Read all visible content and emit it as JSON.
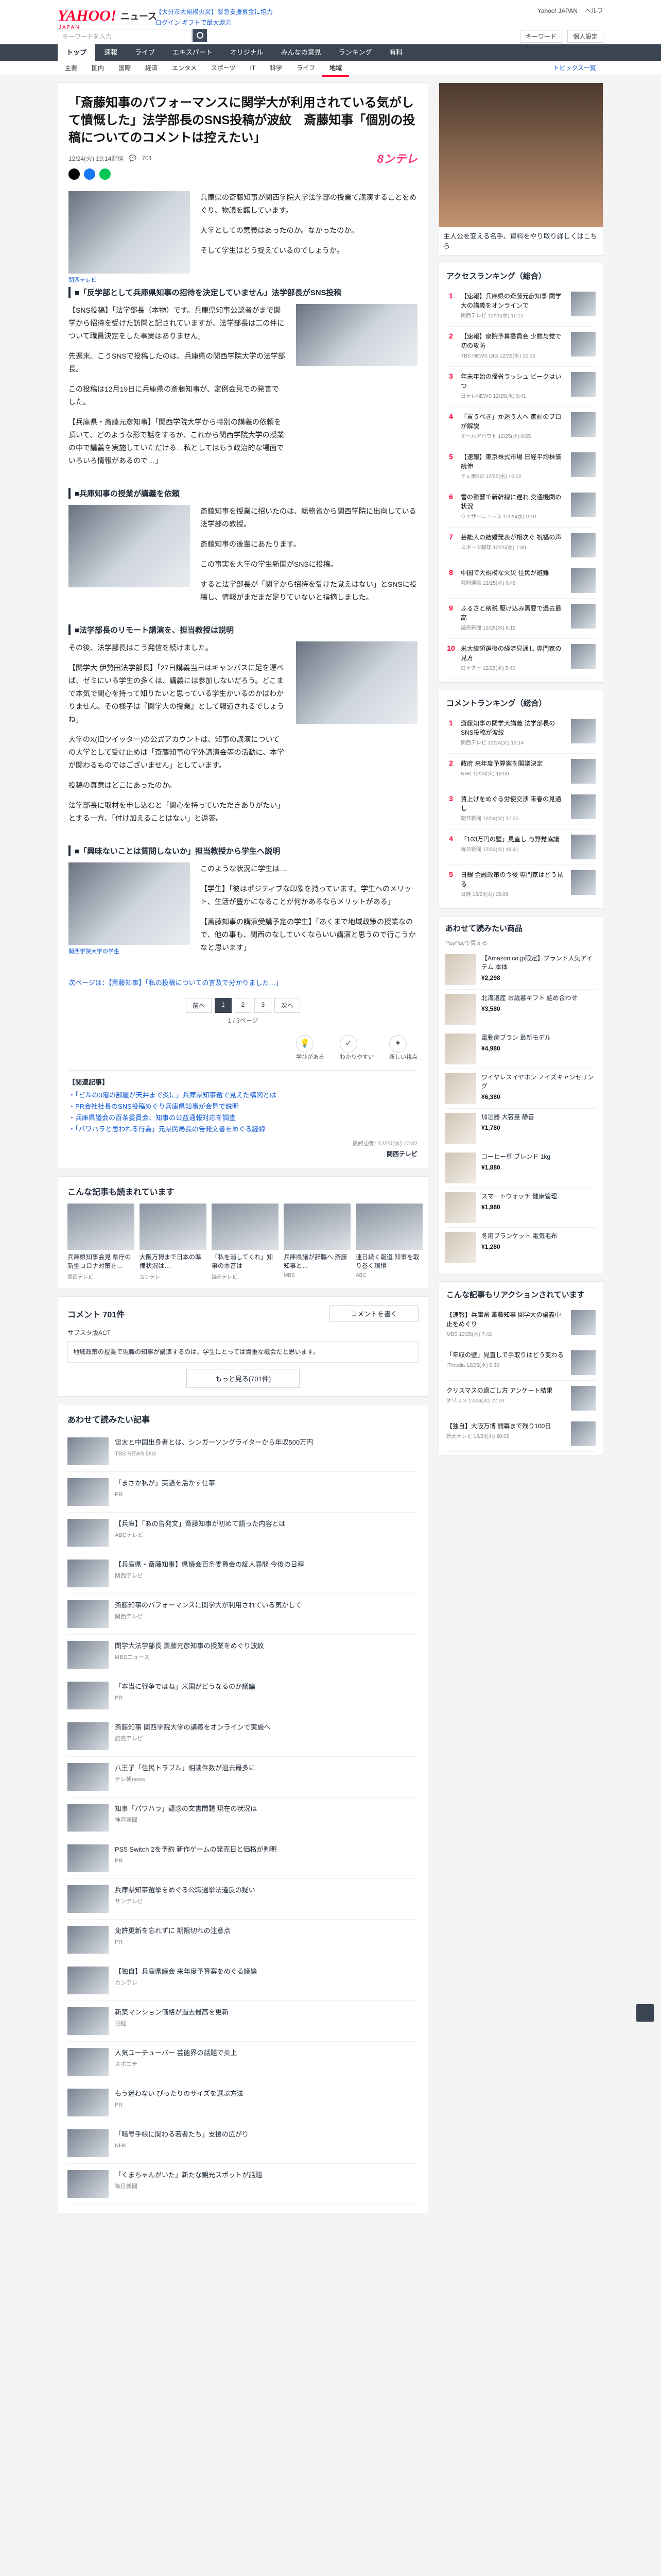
{
  "header": {
    "logo": "YAHOO!",
    "logo_sub": "JAPAN",
    "service": "ニュース",
    "promo1": "【大分市大規模火災】緊急支援募金に協力",
    "promo2": "ログイン ギフトで最大還元",
    "util_links": [
      "Yahoo! JAPAN",
      "ヘルプ"
    ],
    "search_placeholder": "キーワードを入力",
    "search_right": [
      "キーワード",
      "個人設定"
    ]
  },
  "nav": {
    "items": [
      "トップ",
      "速報",
      "ライブ",
      "エキスパート",
      "オリジナル",
      "みんなの意見",
      "ランキング",
      "有料"
    ],
    "active": 0
  },
  "subnav": {
    "items": [
      "主要",
      "国内",
      "国際",
      "経済",
      "エンタメ",
      "スポーツ",
      "IT",
      "科学",
      "ライフ",
      "地域"
    ],
    "active": 9,
    "topics": "トピックス一覧"
  },
  "article": {
    "title": "「斎藤知事のパフォーマンスに関学大が利用されている気がして憤慨した」法学部長のSNS投稿が波紋　斎藤知事「個別の投稿についてのコメントは控えたい」",
    "date": "12/24(火) 19:14配信",
    "comments": "701",
    "brand": "8ンテレ",
    "sections": [
      {
        "caption": "関西テレビ",
        "paras": [
          "兵庫県の斎藤知事が関西学院大学法学部の授業で講演することをめぐり、物議を醸しています。",
          "大学としての意義はあったのか。なかったのか。",
          "そして学生はどう捉えているのでしょうか。"
        ]
      }
    ],
    "h1": "■「反学部として兵庫県知事の招待を決定していません」法学部長がSNS投稿",
    "b1": [
      "【SNS投稿】「法学部長（本物）です。兵庫県知事公認者がまで関学から招待を受けた訪問と記されていますが、法学部長は二の件について職員決定をした事実はありません」",
      "先週末、こうSNSで投稿したのは、兵庫県の関西学院大学の法学部長。",
      "この投稿は12月19日に兵庫県の斎藤知事が、定例会見での発言でした。",
      "【兵庫県・斎藤元彦知事】「関西学院大学から特別の講義の依頼を頂いて、どのような形で話をするか、これから関西学院大学の授業の中で講義を実施していただける…私としてはもう政治的な場面でいろいろ情報があるので…」"
    ],
    "h2": "■兵庫知事の授業が講義を依頼",
    "b2": [
      "斎藤知事を授業に招いたのは、総務省から関西学院に出向している法学部の教授。",
      "斎藤知事の後輩にあたります。",
      "この事実を大学の学生新聞がSNSに投稿。",
      "すると法学部長が「関学から招待を受けた覚えはない」とSNSに投稿し、情報がまだまだ足りていないと指摘しました。"
    ],
    "h3": "■法学部長のリモート講演を、担当教授は説明",
    "b3": [
      "その後、法学部長はこう発信を続けました。",
      "【関学大 伊勢田法学部長】「27日講義当日はキャンパスに足を運べば、ゼミにいる学生の多くは、講義には参加しないだろう。どこまで本気で関心を持って知りたいと思っている学生がいるのかはわかりません。その様子は『関学大の授業』として報道されるでしょうね」",
      "大学のX(旧ツイッター)の公式アカウントは、知事の講演についての大学として受け止めは「斎藤知事の学外講演会等の活動に、本学が関わるものではございません」としています。",
      "投稿の真意はどこにあったのか。",
      "法学部長に取材を申し込むと「関心を持っていただきありがたい」とする一方、「付け加えることはない」と返答。"
    ],
    "h4": "■「興味ないことは質問しないか」担当教授から学生へ説明",
    "b4": [
      "このような状況に学生は…",
      "【学生】「彼はポジティブな印象を持っています。学生へのメリット、生活が豊かになることが何かあるならメリットがある」",
      "【斎藤知事の講演受講予定の学生】「あくまで地域政策の授業なので、他の事も、関西のなしていくならいい講演と思うので行こうかなと思います」"
    ],
    "b4_caption": "関西学院大学の学生",
    "more_label": "次ページは：【斎藤知事】「私の投稿についての言及で分かりました…」",
    "pager": [
      "前へ",
      "1",
      "2",
      "3",
      "次へ"
    ],
    "page_count": "1 / 3ページ",
    "reactions": [
      "学びがある",
      "わかりやすい",
      "新しい視点"
    ],
    "reaction_icons": [
      "💡",
      "✓",
      "✦"
    ],
    "related_title": "【関連記事】",
    "related": [
      "・「ビルの3階の部屋が天井まで炎に」兵庫県知事選で見えた構図とは",
      "・PR会社社長のSNS投稿めぐり兵庫県知事が会見で説明",
      "・兵庫県議会の百条委員会、知事の公益通報対応を調査",
      "・「パワハラと思われる行為」元県民局長の告発文書をめぐる経緯"
    ],
    "source_note": "最終更新: 12/25(水) 10:42",
    "source": "関西テレビ"
  },
  "similar": {
    "title": "こんな記事も読まれています",
    "items": [
      {
        "cap": "兵庫県知事会見 県庁の新型コロナ対策を…",
        "src": "関西テレビ"
      },
      {
        "cap": "大阪万博まで日本の準備状況は…",
        "src": "カンテレ"
      },
      {
        "cap": "「私を消してくれ」知事の本音は",
        "src": "読売テレビ"
      },
      {
        "cap": "兵庫県議が辞職へ 斎藤知事と…",
        "src": "MBS"
      },
      {
        "cap": "連日続く報道 知事を取り巻く環境",
        "src": "ABC"
      }
    ]
  },
  "comments_block": {
    "title": "コメント",
    "count": "701件",
    "post": "コメントを書く",
    "sample_label": "サブスタ版ACT",
    "sample_text": "地域政策の授業で現職の知事が講演するのは、学生にとっては貴重な機会だと思います。",
    "more": "もっと見る(701件)"
  },
  "reco": {
    "title": "あわせて読みたい記事",
    "items": [
      {
        "txt": "宙太と中国出身者とは、シンガーソングライターから年収500万円",
        "meta": "TBS NEWS DIG"
      },
      {
        "txt": "「まさか私が」英語を活かす仕事",
        "meta": "PR"
      },
      {
        "txt": "【兵庫】「あの告発文」斎藤知事が初めて語った内容とは",
        "meta": "ABCテレビ"
      },
      {
        "txt": "【兵庫県・斎藤知事】県議会百条委員会の証人尋問 今後の日程",
        "meta": "関西テレビ"
      },
      {
        "txt": "斎藤知事のパフォーマンスに関学大が利用されている気がして",
        "meta": "関西テレビ"
      },
      {
        "txt": "関学大法学部長 斎藤元彦知事の授業をめぐり波紋",
        "meta": "MBSニュース"
      },
      {
        "txt": "「本当に戦争ではね」米国がどうなるのか議論",
        "meta": "PR"
      },
      {
        "txt": "斎藤知事 関西学院大学の講義をオンラインで実施へ",
        "meta": "読売テレビ"
      },
      {
        "txt": "八王子「住民トラブル」相談件数が過去最多に",
        "meta": "テレ朝news"
      },
      {
        "txt": "知事「パワハラ」疑惑の文書問題 現在の状況は",
        "meta": "神戸新聞"
      },
      {
        "txt": "PS5 Switch 2を予約 新作ゲームの発売日と価格が判明",
        "meta": "PR"
      },
      {
        "txt": "兵庫県知事選挙をめぐる公職選挙法違反の疑い",
        "meta": "サンテレビ"
      },
      {
        "txt": "免許更新を忘れずに 期限切れの注意点",
        "meta": "PR"
      },
      {
        "txt": "【独自】兵庫県議会 来年度予算案をめぐる議論",
        "meta": "カンテレ"
      },
      {
        "txt": "新築マンション価格が過去最高を更新",
        "meta": "日経"
      },
      {
        "txt": "人気ユーチューバー 芸能界の話題で炎上",
        "meta": "スポニチ"
      },
      {
        "txt": "もう迷わない ぴったりのサイズを選ぶ方法",
        "meta": "PR"
      },
      {
        "txt": "「暗号手帳に関わる若者たち」支援の広がり",
        "meta": "NHK"
      },
      {
        "txt": "「くまちゃんがいた」新たな観光スポットが話題",
        "meta": "毎日新聞"
      }
    ]
  },
  "sidebar": {
    "ad_caption": "主人公を変える名手、資料をやり取り詳しくはこちら",
    "ad_link": "詳しくはこちら",
    "access_title": "アクセスランキング（総合）",
    "access": [
      {
        "txt": "【速報】兵庫県の斎藤元彦知事 関学大の講義をオンラインで",
        "t": "関西テレビ 12/25(水) 11:12"
      },
      {
        "txt": "【速報】衆院予算委員会 少数与党で初の攻防",
        "t": "TBS NEWS DIG 12/25(水) 10:32"
      },
      {
        "txt": "年末年始の帰省ラッシュ ピークはいつ",
        "t": "日テレNEWS 12/25(水) 9:41"
      },
      {
        "txt": "「買うべき」か迷う人へ 家計のプロが解説",
        "t": "オールアバウト 12/25(水) 8:55"
      },
      {
        "txt": "【速報】東京株式市場 日経平均株価 続伸",
        "t": "テレ東BIZ 12/25(水) 10:02"
      },
      {
        "txt": "雪の影響で新幹線に遅れ 交通機関の状況",
        "t": "ウェザーニュース 12/25(水) 9:10"
      },
      {
        "txt": "芸能人の結婚発表が相次ぐ 祝福の声",
        "t": "スポーツ報知 12/25(水) 7:30"
      },
      {
        "txt": "中国で大規模な火災 住民が避難",
        "t": "共同通信 12/25(水) 6:48"
      },
      {
        "txt": "ふるさと納税 駆け込み需要で過去最高",
        "t": "読売新聞 12/25(水) 6:15"
      },
      {
        "txt": "米大統領選後の経済見通し 専門家の見方",
        "t": "ロイター 12/25(水) 5:40"
      }
    ],
    "comment_title": "コメントランキング（総合）",
    "comment_rank": [
      {
        "txt": "斎藤知事の関学大講義 法学部長のSNS投稿が波紋",
        "t": "関西テレビ 12/24(火) 19:14"
      },
      {
        "txt": "政府 来年度予算案を閣議決定",
        "t": "NHK 12/24(火) 18:00"
      },
      {
        "txt": "賃上げをめぐる労使交渉 来春の見通し",
        "t": "朝日新聞 12/24(火) 17:20"
      },
      {
        "txt": "「103万円の壁」見直し 与野党協議",
        "t": "毎日新聞 12/24(火) 16:41"
      },
      {
        "txt": "日銀 金融政策の今後 専門家はどう見る",
        "t": "日経 12/24(火) 15:08"
      }
    ],
    "shop_title": "あわせて読みたい商品",
    "shop_sub": "PayPayで買える",
    "products": [
      {
        "name": "【Amazon.co.jp限定】ブランド人気アイテム 本体",
        "price": "¥2,298"
      },
      {
        "name": "北海道産 お歳暮ギフト 詰め合わせ",
        "price": "¥3,580"
      },
      {
        "name": "電動歯ブラシ 最新モデル",
        "price": "¥4,980"
      },
      {
        "name": "ワイヤレスイヤホン ノイズキャンセリング",
        "price": "¥6,380"
      },
      {
        "name": "加湿器 大容量 静音",
        "price": "¥1,780"
      },
      {
        "name": "コーヒー豆 ブレンド 1kg",
        "price": "¥1,880"
      },
      {
        "name": "スマートウォッチ 健康管理",
        "price": "¥1,980"
      },
      {
        "name": "冬用ブランケット 電気毛布",
        "price": "¥1,280"
      }
    ],
    "feature_title": "こんな記事もリアクションされています",
    "features": [
      {
        "txt": "【速報】兵庫県 斎藤知事 関学大の講義中止をめぐり",
        "t": "MBS 12/25(水) 7:42"
      },
      {
        "txt": "「年収の壁」見直しで手取りはどう変わる",
        "t": "ITmedia 12/25(水) 6:30"
      },
      {
        "txt": "クリスマスの過ごし方 アンケート結果",
        "t": "オリコン 12/24(火) 22:10"
      },
      {
        "txt": "【独自】大阪万博 開幕まで残り100日",
        "t": "読売テレビ 12/24(火) 20:05"
      }
    ]
  }
}
